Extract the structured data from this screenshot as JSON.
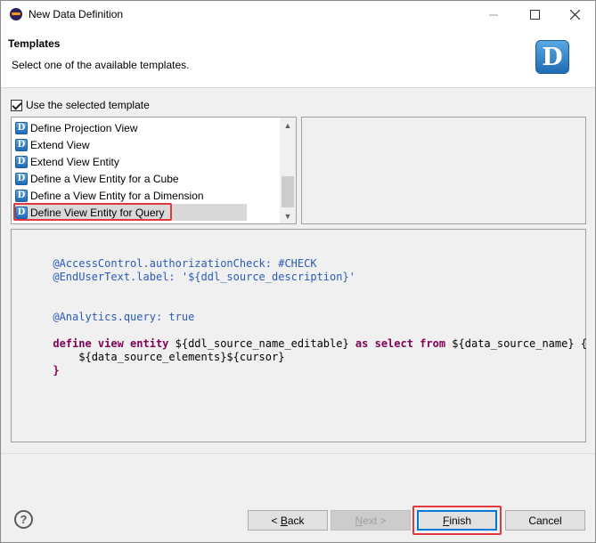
{
  "window": {
    "title": "New Data Definition"
  },
  "header": {
    "title": "Templates",
    "description": "Select one of the available templates.",
    "logo_letter": "D"
  },
  "use_template": {
    "label": "Use the selected template",
    "checked": true
  },
  "templates": [
    {
      "label": "Define Projection View",
      "selected": false
    },
    {
      "label": "Extend View",
      "selected": false
    },
    {
      "label": "Extend View Entity",
      "selected": false
    },
    {
      "label": "Define a View Entity for a Cube",
      "selected": false
    },
    {
      "label": "Define a View Entity for a Dimension",
      "selected": false
    },
    {
      "label": "Define View Entity for Query",
      "selected": true
    }
  ],
  "template_icon_letter": "D",
  "editor": {
    "line1": "@AccessControl.authorizationCheck: #CHECK",
    "line2_a": "@EndUserText.label: ",
    "line2_b": "'${ddl_source_description}'",
    "line3": "@Analytics.query: true",
    "line4_kw1": "define view entity",
    "line4_t1": " ${ddl_source_name_editable} ",
    "line4_kw2": "as select from",
    "line4_t2": " ${data_source_name} {",
    "line5": "    ${data_source_elements}${cursor}",
    "line6": "}"
  },
  "buttons": {
    "back_prefix": "< ",
    "back_mnemonic": "B",
    "back_rest": "ack",
    "next_mnemonic": "N",
    "next_rest": "ext >",
    "finish_mnemonic": "F",
    "finish_rest": "inish",
    "cancel": "Cancel"
  },
  "icons": {
    "app": "eclipse-icon",
    "help": "help-icon",
    "minimize": "minimize-icon",
    "maximize": "maximize-icon",
    "close": "close-icon"
  },
  "colors": {
    "highlight": "#e0383e",
    "focus": "#0078d7",
    "keyword": "#7f0055",
    "annotation": "#2a5bb8"
  }
}
